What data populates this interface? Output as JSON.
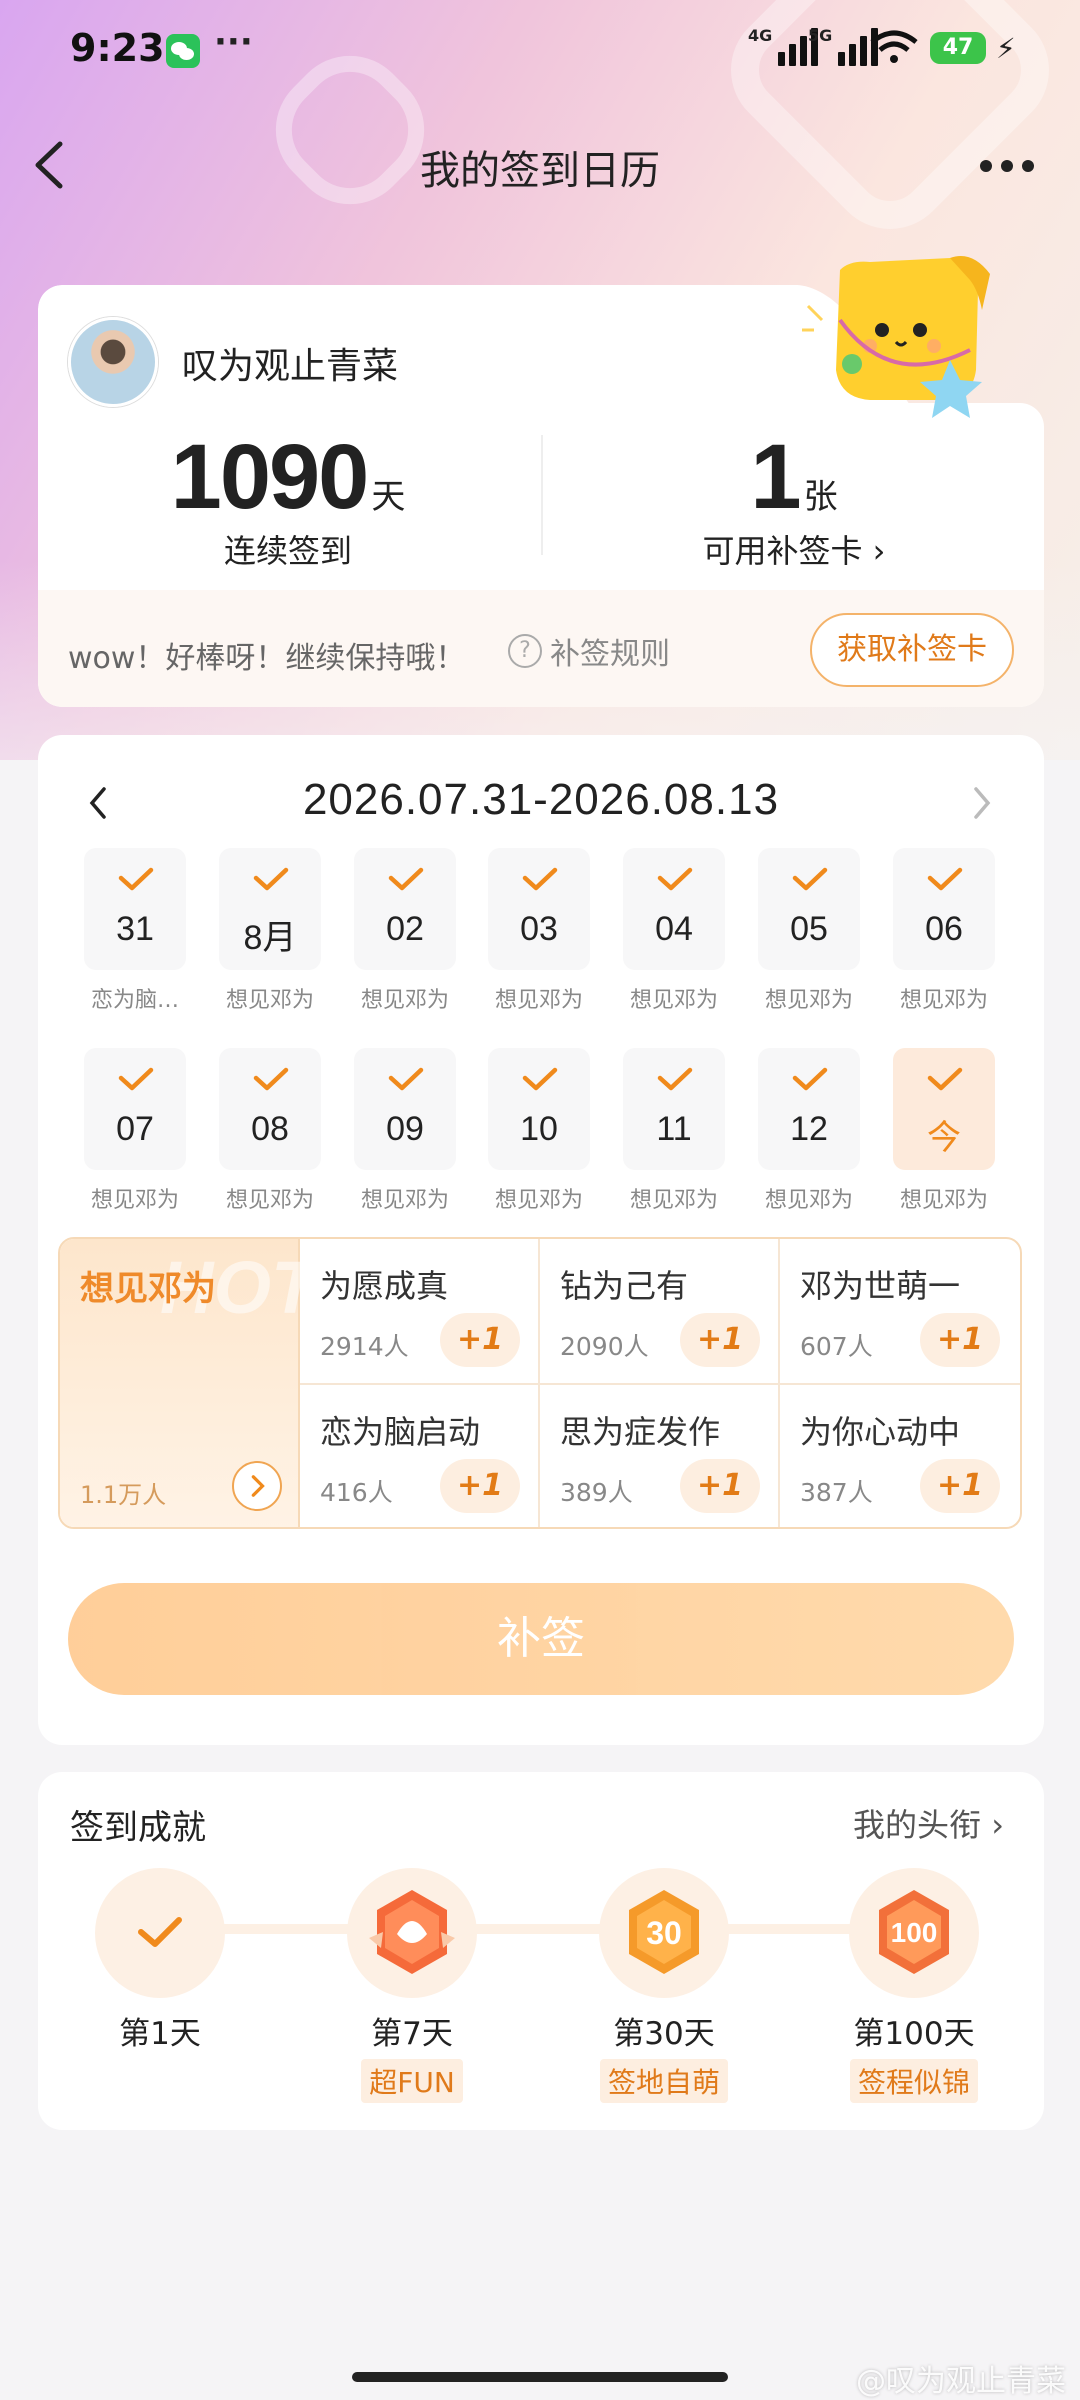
{
  "status": {
    "time": "9:23",
    "more": "···",
    "net1": "4G",
    "net2": "5G",
    "battery": "47"
  },
  "nav": {
    "title": "我的签到日历"
  },
  "profile": {
    "username": "叹为观止青菜",
    "streak_value": "1090",
    "streak_unit": "天",
    "streak_caption": "连续签到",
    "cards_value": "1",
    "cards_unit": "张",
    "cards_caption": "可用补签卡 ›",
    "cheer": "wow！好棒呀！继续保持哦！",
    "rules": "补签规则",
    "get_card_button": "获取补签卡"
  },
  "calendar": {
    "range": "2026.07.31-2026.08.13",
    "row1": [
      {
        "day": "31",
        "label": "恋为脑…"
      },
      {
        "day": "8月",
        "label": "想见邓为"
      },
      {
        "day": "02",
        "label": "想见邓为"
      },
      {
        "day": "03",
        "label": "想见邓为"
      },
      {
        "day": "04",
        "label": "想见邓为"
      },
      {
        "day": "05",
        "label": "想见邓为"
      },
      {
        "day": "06",
        "label": "想见邓为"
      }
    ],
    "row2": [
      {
        "day": "07",
        "label": "想见邓为"
      },
      {
        "day": "08",
        "label": "想见邓为"
      },
      {
        "day": "09",
        "label": "想见邓为"
      },
      {
        "day": "10",
        "label": "想见邓为"
      },
      {
        "day": "11",
        "label": "想见邓为"
      },
      {
        "day": "12",
        "label": "想见邓为"
      },
      {
        "day": "今",
        "label": "想见邓为"
      }
    ]
  },
  "topics": {
    "hot_label": "HOT",
    "main": {
      "name": "想见邓为",
      "count": "1.1万人"
    },
    "items": [
      {
        "name": "为愿成真",
        "count": "2914人",
        "plus": "+1"
      },
      {
        "name": "钻为己有",
        "count": "2090人",
        "plus": "+1"
      },
      {
        "name": "邓为世萌一",
        "count": "607人",
        "plus": "+1"
      },
      {
        "name": "恋为脑启动",
        "count": "416人",
        "plus": "+1"
      },
      {
        "name": "思为症发作",
        "count": "389人",
        "plus": "+1"
      },
      {
        "name": "为你心动中",
        "count": "387人",
        "plus": "+1"
      }
    ]
  },
  "buqian_button": "补签",
  "achievements": {
    "title": "签到成就",
    "link": "我的头衔 ›",
    "badges": [
      {
        "day": "第1天",
        "tag": ""
      },
      {
        "day": "第7天",
        "tag": "超FUN"
      },
      {
        "day": "第30天",
        "tag": "签地自萌"
      },
      {
        "day": "第100天",
        "tag": "签程似锦"
      }
    ]
  },
  "watermark": "@叹为观止青菜",
  "colors": {
    "accent": "#f08a1c",
    "button": "#ffc98e"
  }
}
